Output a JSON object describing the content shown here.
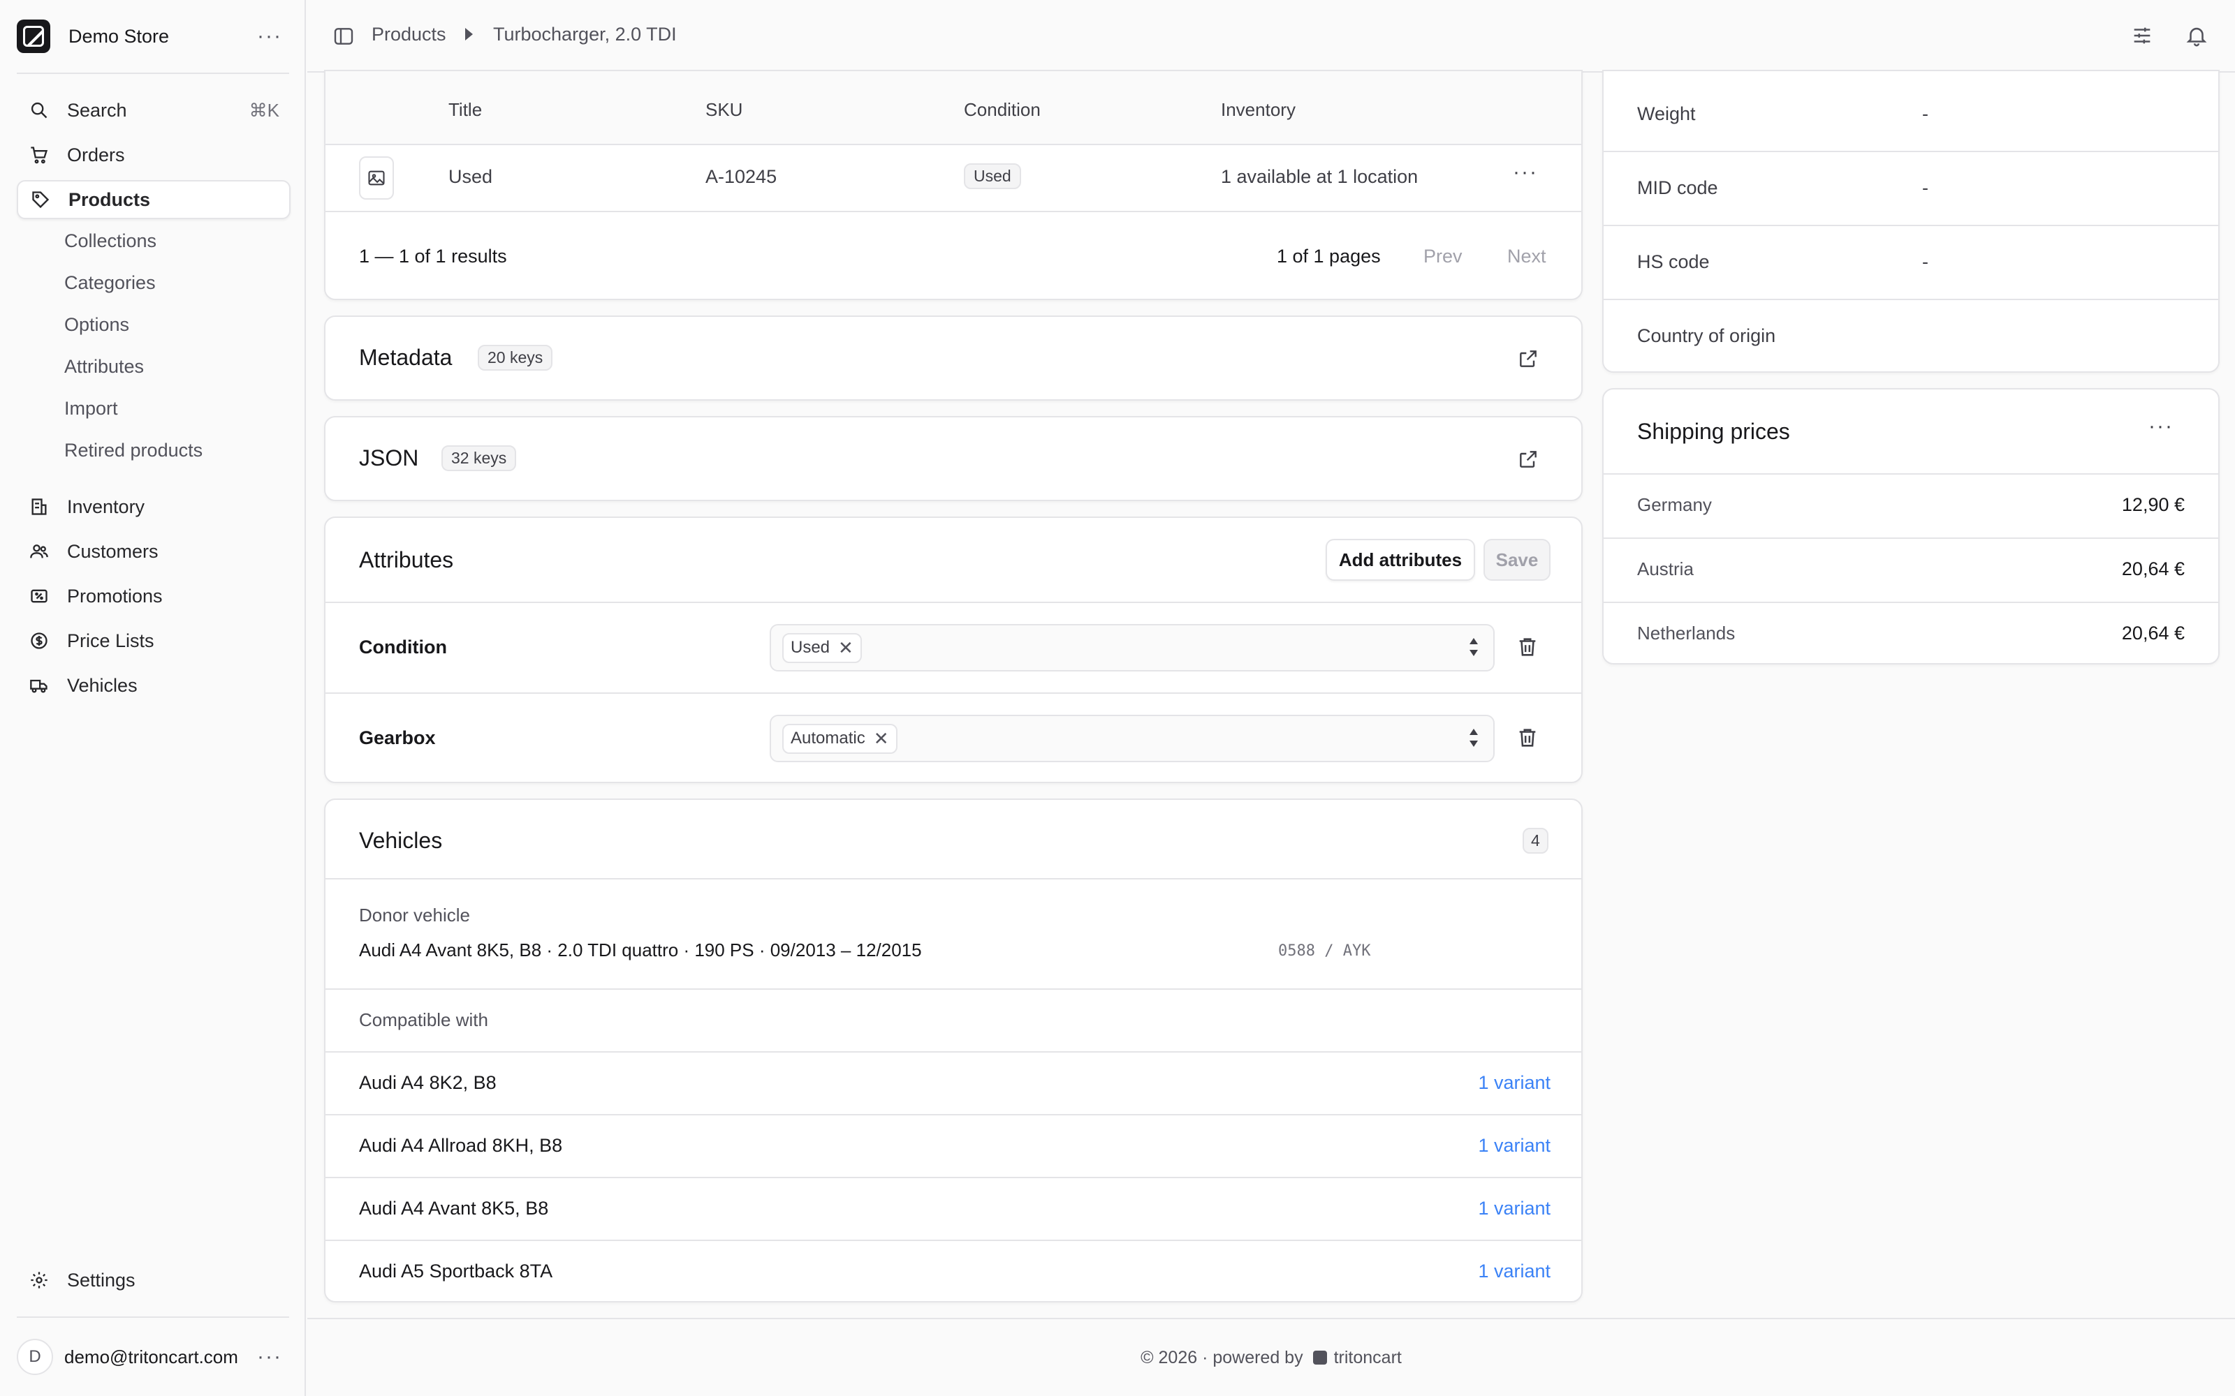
{
  "store": {
    "name": "Demo Store"
  },
  "nav": {
    "search": {
      "label": "Search",
      "shortcut": "⌘K"
    },
    "orders": "Orders",
    "products": "Products",
    "sub": [
      "Collections",
      "Categories",
      "Options",
      "Attributes",
      "Import",
      "Retired products"
    ],
    "inventory": "Inventory",
    "customers": "Customers",
    "promotions": "Promotions",
    "price_lists": "Price Lists",
    "vehicles": "Vehicles",
    "settings": "Settings"
  },
  "user": {
    "initial": "D",
    "email": "demo@tritoncart.com"
  },
  "breadcrumb": {
    "root": "Products",
    "current": "Turbocharger, 2.0 TDI"
  },
  "variants": {
    "headers": {
      "title": "Title",
      "sku": "SKU",
      "condition": "Condition",
      "inventory": "Inventory"
    },
    "rows": [
      {
        "title": "Used",
        "sku": "A-10245",
        "condition": "Used",
        "inventory": "1 available at 1 location"
      }
    ],
    "results": "1 — 1 of 1 results",
    "pages": "1 of 1 pages",
    "prev": "Prev",
    "next": "Next"
  },
  "metadata": {
    "title": "Metadata",
    "badge": "20 keys"
  },
  "json": {
    "title": "JSON",
    "badge": "32 keys"
  },
  "attributes": {
    "title": "Attributes",
    "add_button": "Add attributes",
    "save_button": "Save",
    "rows": [
      {
        "label": "Condition",
        "value": "Used"
      },
      {
        "label": "Gearbox",
        "value": "Automatic"
      }
    ]
  },
  "vehicles": {
    "title": "Vehicles",
    "count": "4",
    "donor_label": "Donor vehicle",
    "donor_text": "Audi A4 Avant 8K5, B8 · 2.0 TDI quattro · 190 PS · 09/2013 – 12/2015",
    "donor_codes": "0588 / AYK",
    "compatible_label": "Compatible with",
    "compatible": [
      {
        "name": "Audi A4 8K2, B8",
        "link": "1 variant"
      },
      {
        "name": "Audi A4 Allroad 8KH, B8",
        "link": "1 variant"
      },
      {
        "name": "Audi A4 Avant 8K5, B8",
        "link": "1 variant"
      },
      {
        "name": "Audi A5 Sportback 8TA",
        "link": "1 variant"
      }
    ]
  },
  "details": {
    "rows": [
      {
        "label": "Weight",
        "value": "-"
      },
      {
        "label": "MID code",
        "value": "-"
      },
      {
        "label": "HS code",
        "value": "-"
      },
      {
        "label": "Country of origin",
        "value": ""
      }
    ]
  },
  "shipping": {
    "title": "Shipping prices",
    "rows": [
      {
        "country": "Germany",
        "price": "12,90 €"
      },
      {
        "country": "Austria",
        "price": "20,64 €"
      },
      {
        "country": "Netherlands",
        "price": "20,64 €"
      }
    ]
  },
  "footer": {
    "text": "© 2026 · powered by",
    "brand": "tritoncart"
  }
}
